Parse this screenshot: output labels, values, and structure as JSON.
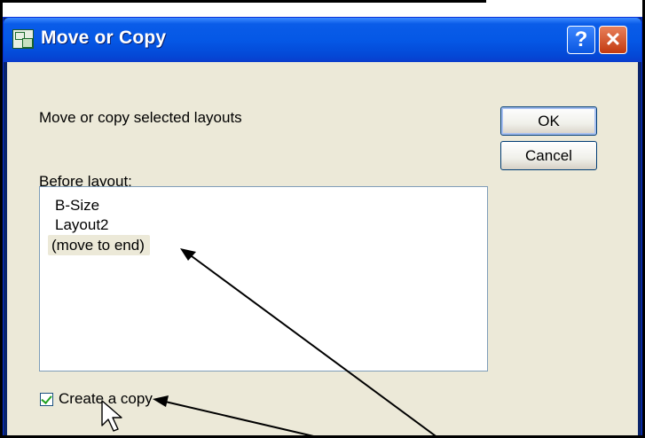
{
  "window": {
    "title": "Move or Copy",
    "help_glyph": "?",
    "close_glyph": "✕"
  },
  "dialog": {
    "subtitle": "Move or copy selected layouts",
    "list_label": "Before layout:",
    "list_items": [
      "B-Size",
      "Layout2",
      "(move to end)"
    ],
    "selected_item": "(move to end)",
    "checkbox_label": "Create a copy",
    "checkbox_checked": true,
    "ok_label": "OK",
    "cancel_label": "Cancel"
  },
  "icons": [
    "app-icon",
    "help-icon",
    "close-icon",
    "checkmark-icon",
    "mouse-cursor-icon",
    "annotation-arrow"
  ],
  "colors": {
    "titlebar": "#0558e6",
    "dialog_bg": "#ece9d8",
    "close_button": "#c23a10",
    "checkmark": "#21a121"
  }
}
